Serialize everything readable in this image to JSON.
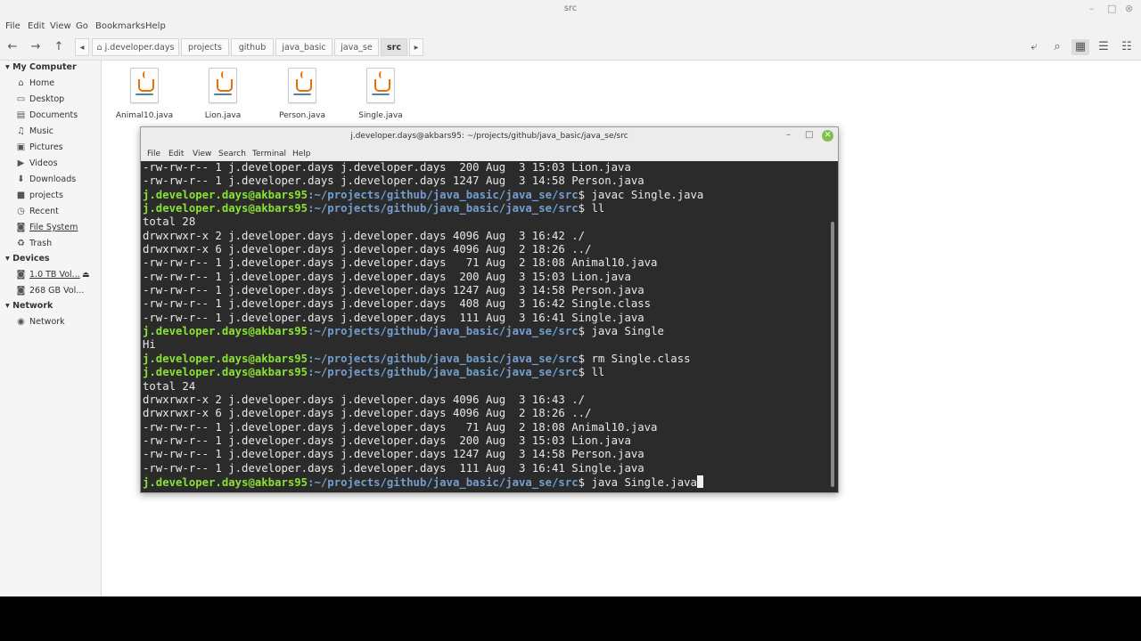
{
  "fm": {
    "title": "src",
    "menu": [
      "File",
      "Edit",
      "View",
      "Go",
      "Bookmarks",
      "Help"
    ],
    "breadcrumbs": [
      "j.developer.days",
      "projects",
      "github",
      "java_basic",
      "java_se",
      "src"
    ],
    "sidebar": {
      "my_computer": {
        "heading": "My Computer",
        "items": [
          "Home",
          "Desktop",
          "Documents",
          "Music",
          "Pictures",
          "Videos",
          "Downloads",
          "projects",
          "Recent",
          "File System",
          "Trash"
        ]
      },
      "devices": {
        "heading": "Devices",
        "items": [
          "1.0 TB Vol...",
          "268 GB Vol..."
        ]
      },
      "network": {
        "heading": "Network",
        "items": [
          "Network"
        ]
      }
    },
    "files": [
      "Animal10.java",
      "Lion.java",
      "Person.java",
      "Single.java"
    ]
  },
  "terminal": {
    "title": "j.developer.days@akbars95: ~/projects/github/java_basic/java_se/src",
    "menu": [
      "File",
      "Edit",
      "View",
      "Search",
      "Terminal",
      "Help"
    ],
    "prompt_user": "j.developer.days@akbars95",
    "prompt_path": ":~/projects/github/java_basic/java_se/src",
    "lines": [
      {
        "type": "out",
        "text": "-rw-rw-r-- 1 j.developer.days j.developer.days  200 Aug  3 15:03 Lion.java"
      },
      {
        "type": "out",
        "text": "-rw-rw-r-- 1 j.developer.days j.developer.days 1247 Aug  3 14:58 Person.java"
      },
      {
        "type": "cmd",
        "text": "$ javac Single.java"
      },
      {
        "type": "cmd",
        "text": "$ ll"
      },
      {
        "type": "out",
        "text": "total 28"
      },
      {
        "type": "out",
        "text": "drwxrwxr-x 2 j.developer.days j.developer.days 4096 Aug  3 16:42 ./"
      },
      {
        "type": "out",
        "text": "drwxrwxr-x 6 j.developer.days j.developer.days 4096 Aug  2 18:26 ../"
      },
      {
        "type": "out",
        "text": "-rw-rw-r-- 1 j.developer.days j.developer.days   71 Aug  2 18:08 Animal10.java"
      },
      {
        "type": "out",
        "text": "-rw-rw-r-- 1 j.developer.days j.developer.days  200 Aug  3 15:03 Lion.java"
      },
      {
        "type": "out",
        "text": "-rw-rw-r-- 1 j.developer.days j.developer.days 1247 Aug  3 14:58 Person.java"
      },
      {
        "type": "out",
        "text": "-rw-rw-r-- 1 j.developer.days j.developer.days  408 Aug  3 16:42 Single.class"
      },
      {
        "type": "out",
        "text": "-rw-rw-r-- 1 j.developer.days j.developer.days  111 Aug  3 16:41 Single.java"
      },
      {
        "type": "cmd",
        "text": "$ java Single"
      },
      {
        "type": "out",
        "text": "Hi"
      },
      {
        "type": "cmd",
        "text": "$ rm Single.class"
      },
      {
        "type": "cmd",
        "text": "$ ll"
      },
      {
        "type": "out",
        "text": "total 24"
      },
      {
        "type": "out",
        "text": "drwxrwxr-x 2 j.developer.days j.developer.days 4096 Aug  3 16:43 ./"
      },
      {
        "type": "out",
        "text": "drwxrwxr-x 6 j.developer.days j.developer.days 4096 Aug  2 18:26 ../"
      },
      {
        "type": "out",
        "text": "-rw-rw-r-- 1 j.developer.days j.developer.days   71 Aug  2 18:08 Animal10.java"
      },
      {
        "type": "out",
        "text": "-rw-rw-r-- 1 j.developer.days j.developer.days  200 Aug  3 15:03 Lion.java"
      },
      {
        "type": "out",
        "text": "-rw-rw-r-- 1 j.developer.days j.developer.days 1247 Aug  3 14:58 Person.java"
      },
      {
        "type": "out",
        "text": "-rw-rw-r-- 1 j.developer.days j.developer.days  111 Aug  3 16:41 Single.java"
      },
      {
        "type": "input",
        "text": "$ java Single.java"
      }
    ]
  },
  "colors": {
    "prompt_user": "#8ae234",
    "prompt_path": "#729fcf",
    "terminal_bg": "#2b2b2b",
    "java_orange": "#e76f00"
  }
}
